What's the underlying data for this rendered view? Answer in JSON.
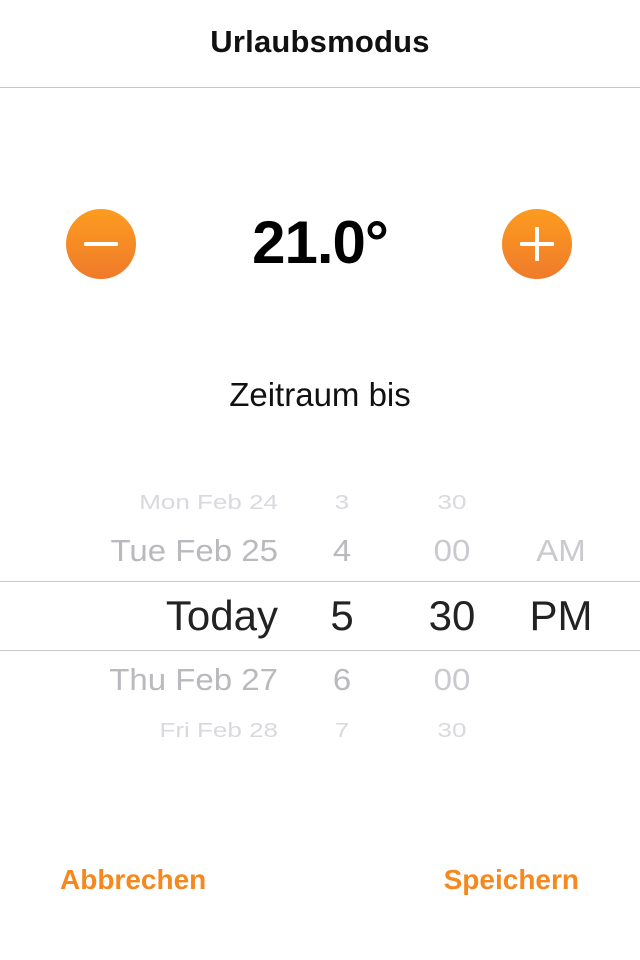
{
  "header": {
    "title": "Urlaubsmodus"
  },
  "thermostat": {
    "value": "21.0°",
    "decrease_icon": "minus-icon",
    "increase_icon": "plus-icon"
  },
  "period": {
    "label": "Zeitraum bis"
  },
  "picker": {
    "dates": [
      "Mon Feb 24",
      "Tue Feb 25",
      "Today",
      "Thu Feb 27",
      "Fri Feb 28"
    ],
    "hours": [
      "3",
      "4",
      "5",
      "6",
      "7"
    ],
    "minutes": [
      "30",
      "00",
      "30",
      "00",
      "30"
    ],
    "ampm": [
      "AM",
      "PM"
    ],
    "selected": {
      "date": "Today",
      "hour": "5",
      "minute": "30",
      "ampm": "PM"
    }
  },
  "actions": {
    "cancel_label": "Abbrechen",
    "save_label": "Speichern"
  },
  "colors": {
    "accent": "#f5891f",
    "button_top": "#fc9c1f",
    "button_bottom": "#f07a2b",
    "separator": "#c8c8cc"
  }
}
